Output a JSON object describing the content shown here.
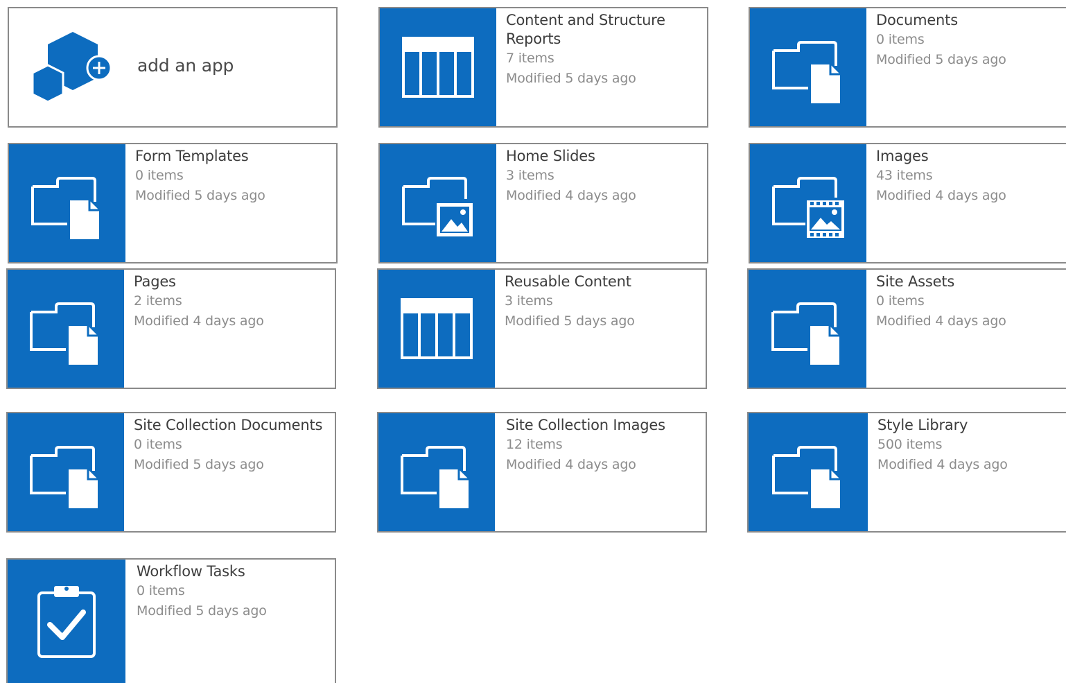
{
  "add_app": {
    "label": "add an app"
  },
  "tiles": [
    {
      "title": "Content and Structure\nReports",
      "count": "7 items",
      "modified": "Modified 5 days ago",
      "icon": "list-icon"
    },
    {
      "title": "Documents",
      "count": "0 items",
      "modified": "Modified 5 days ago",
      "icon": "document-library-icon"
    },
    {
      "title": "Form Templates",
      "count": "0 items",
      "modified": "Modified 5 days ago",
      "icon": "document-library-icon"
    },
    {
      "title": "Home Slides",
      "count": "3 items",
      "modified": "Modified 4 days ago",
      "icon": "picture-library-icon"
    },
    {
      "title": "Images",
      "count": "43 items",
      "modified": "Modified 4 days ago",
      "icon": "asset-library-icon"
    },
    {
      "title": "Pages",
      "count": "2 items",
      "modified": "Modified 4 days ago",
      "icon": "document-library-icon"
    },
    {
      "title": "Reusable Content",
      "count": "3 items",
      "modified": "Modified 5 days ago",
      "icon": "list-icon"
    },
    {
      "title": "Site Assets",
      "count": "0 items",
      "modified": "Modified 4 days ago",
      "icon": "document-library-icon"
    },
    {
      "title": "Site Collection Documents",
      "count": "0 items",
      "modified": "Modified 5 days ago",
      "icon": "document-library-icon"
    },
    {
      "title": "Site Collection Images",
      "count": "12 items",
      "modified": "Modified 4 days ago",
      "icon": "document-library-icon"
    },
    {
      "title": "Style Library",
      "count": "500 items",
      "modified": "Modified 4 days ago",
      "icon": "document-library-icon"
    },
    {
      "title": "Workflow Tasks",
      "count": "0 items",
      "modified": "Modified 5 days ago",
      "icon": "tasks-icon"
    }
  ],
  "colors": {
    "tile_blue": "#0d6cbf",
    "border": "#8a8a8a",
    "title_text": "#3d3d3d",
    "meta_text": "#8c8c8c"
  }
}
